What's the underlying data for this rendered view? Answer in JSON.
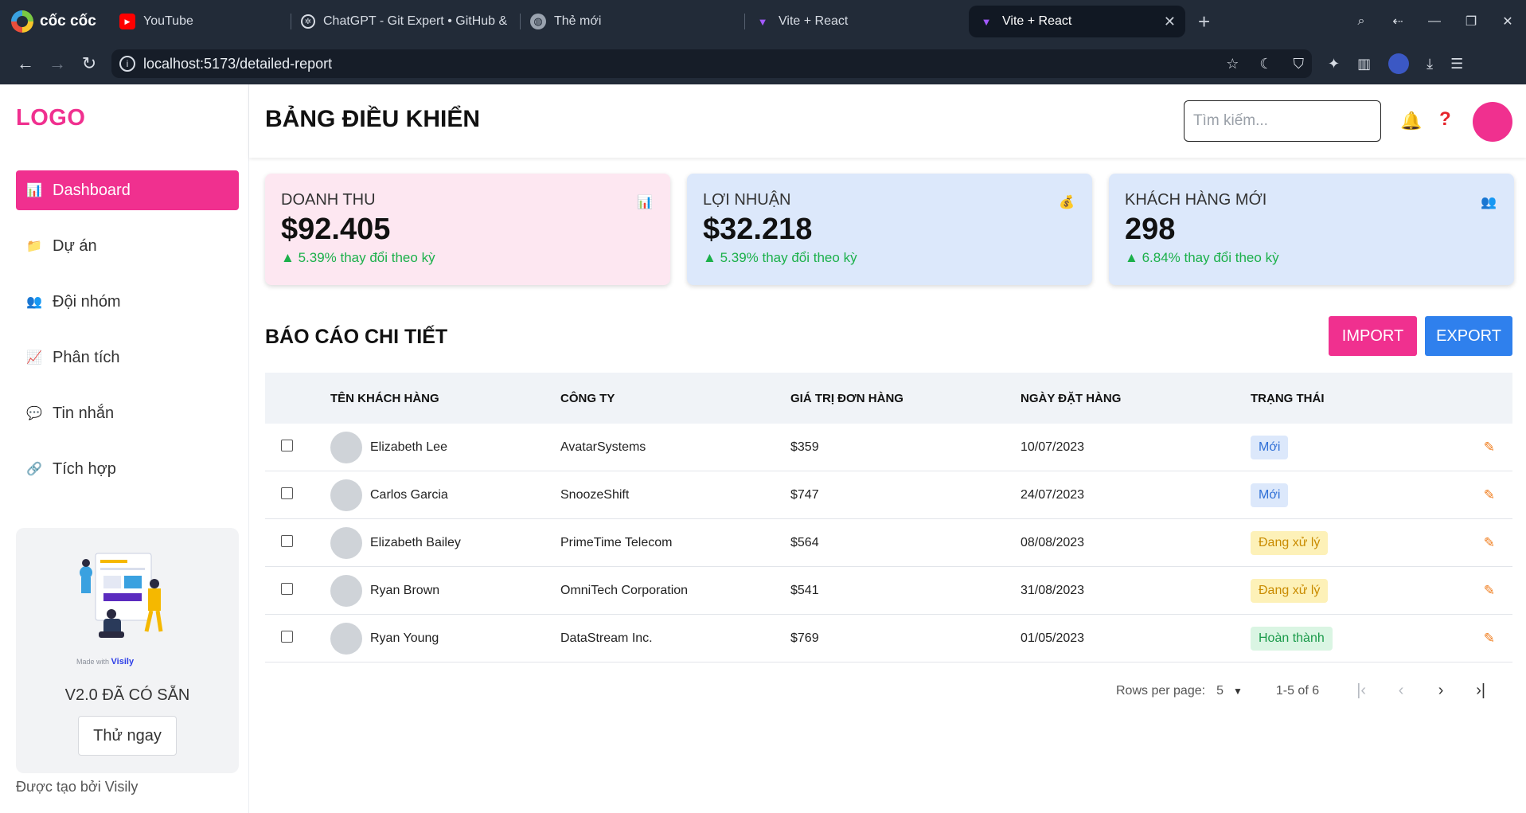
{
  "browser": {
    "brand": "cốc cốc",
    "tabs": [
      {
        "label": "YouTube",
        "icon": "youtube-icon",
        "active": false
      },
      {
        "label": "ChatGPT - Git Expert  • GitHub &",
        "icon": "chatgpt-icon",
        "active": false
      },
      {
        "label": "Thẻ mới",
        "icon": "globe-icon",
        "active": false
      },
      {
        "label": "Vite + React",
        "icon": "vite-icon",
        "active": false
      },
      {
        "label": "Vite + React",
        "icon": "vite-icon",
        "active": true
      }
    ],
    "url": "localhost:5173/detailed-report"
  },
  "sidebar": {
    "logo": "LOGO",
    "items": [
      {
        "label": "Dashboard",
        "icon": "chart-icon",
        "active": true
      },
      {
        "label": "Dự án",
        "icon": "folder-icon",
        "active": false
      },
      {
        "label": "Đội nhóm",
        "icon": "team-icon",
        "active": false
      },
      {
        "label": "Phân tích",
        "icon": "analytics-icon",
        "active": false
      },
      {
        "label": "Tin nhắn",
        "icon": "message-icon",
        "active": false
      },
      {
        "label": "Tích hợp",
        "icon": "link-icon",
        "active": false
      }
    ],
    "promo": {
      "made_with": "Made with",
      "brand": "Visily",
      "title": "V2.0 ĐÃ CÓ SẴN",
      "button": "Thử ngay"
    },
    "footer": "Được tạo bởi Visily"
  },
  "header": {
    "title": "BẢNG ĐIỀU KHIỂN",
    "search_placeholder": "Tìm kiếm..."
  },
  "cards": [
    {
      "label": "DOANH THU",
      "value": "$92.405",
      "change": "5.39% thay đổi theo kỳ",
      "icon": "bar-chart-icon"
    },
    {
      "label": "LỢI NHUẬN",
      "value": "$32.218",
      "change": "5.39% thay đổi theo kỳ",
      "icon": "money-bag-icon"
    },
    {
      "label": "KHÁCH HÀNG MỚI",
      "value": "298",
      "change": "6.84% thay đổi theo kỳ",
      "icon": "users-icon"
    }
  ],
  "report": {
    "title": "BÁO CÁO CHI TIẾT",
    "import_label": "IMPORT",
    "export_label": "EXPORT",
    "columns": [
      "TÊN KHÁCH HÀNG",
      "CÔNG TY",
      "GIÁ TRỊ ĐƠN HÀNG",
      "NGÀY ĐẶT HÀNG",
      "TRẠNG THÁI"
    ],
    "rows": [
      {
        "name": "Elizabeth Lee",
        "company": "AvatarSystems",
        "value": "$359",
        "date": "10/07/2023",
        "status": "Mới",
        "status_bg": "#dce8fb",
        "status_fg": "#2f6fd6"
      },
      {
        "name": "Carlos Garcia",
        "company": "SnoozeShift",
        "value": "$747",
        "date": "24/07/2023",
        "status": "Mới",
        "status_bg": "#dce8fb",
        "status_fg": "#2f6fd6"
      },
      {
        "name": "Elizabeth Bailey",
        "company": "PrimeTime Telecom",
        "value": "$564",
        "date": "08/08/2023",
        "status": "Đang xử lý",
        "status_bg": "#fdf1b8",
        "status_fg": "#c98b00"
      },
      {
        "name": "Ryan Brown",
        "company": "OmniTech Corporation",
        "value": "$541",
        "date": "31/08/2023",
        "status": "Đang xử lý",
        "status_bg": "#fdf1b8",
        "status_fg": "#c98b00"
      },
      {
        "name": "Ryan Young",
        "company": "DataStream Inc.",
        "value": "$769",
        "date": "01/05/2023",
        "status": "Hoàn thành",
        "status_bg": "#daf5e3",
        "status_fg": "#1a9a4a"
      }
    ],
    "pagination": {
      "rows_per_page_label": "Rows per page:",
      "rows_per_page": "5",
      "range": "1-5 of 6"
    }
  },
  "colors": {
    "accent": "#f0308f",
    "export": "#2f80ed",
    "positive": "#1bb04a"
  }
}
